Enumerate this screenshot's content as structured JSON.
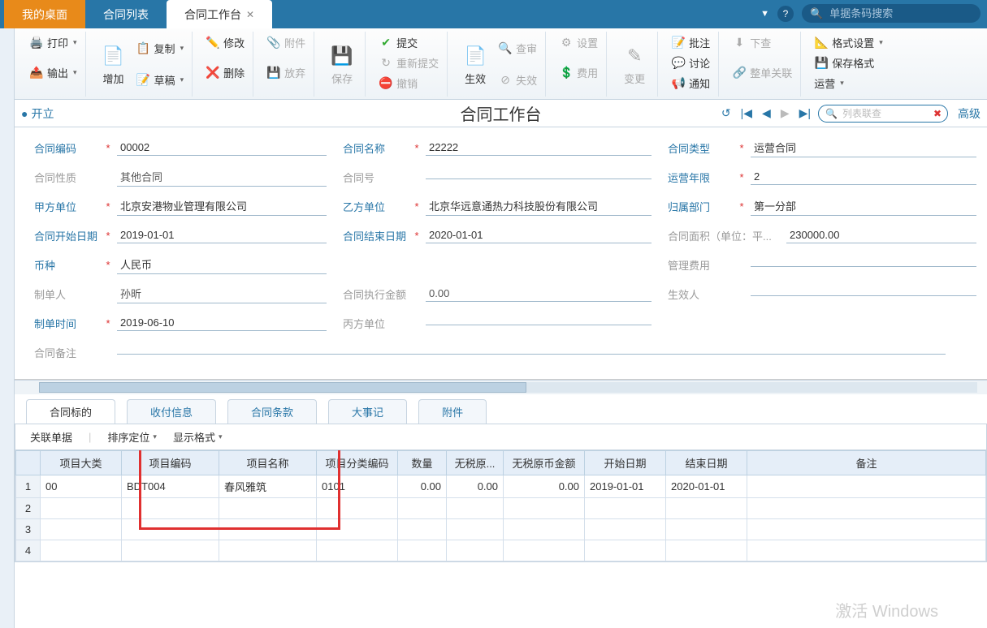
{
  "top_tabs": {
    "t0": "我的桌面",
    "t1": "合同列表",
    "t2": "合同工作台"
  },
  "search": {
    "placeholder": "单据条码搜索"
  },
  "ribbon": {
    "print": "打印",
    "export": "输出",
    "add": "增加",
    "copy": "复制",
    "draft": "草稿",
    "modify": "修改",
    "delete": "删除",
    "attach": "附件",
    "discard": "放弃",
    "save": "保存",
    "submit": "提交",
    "resubmit": "重新提交",
    "revoke": "撤销",
    "effect": "生效",
    "review": "查审",
    "invalid": "失效",
    "settings": "设置",
    "fee": "费用",
    "change": "变更",
    "batch": "批注",
    "discuss": "讨论",
    "notify": "通知",
    "download": "下查",
    "wholeassoc": "整单关联",
    "format": "格式设置",
    "saveformat": "保存格式",
    "operate": "运营"
  },
  "status": {
    "state": "开立",
    "title": "合同工作台",
    "list_ph": "列表联查",
    "advanced": "高级"
  },
  "form": {
    "code_l": "合同编码",
    "code_v": "00002",
    "name_l": "合同名称",
    "name_v": "22222",
    "type_l": "合同类型",
    "type_v": "运营合同",
    "nature_l": "合同性质",
    "nature_v": "其他合同",
    "no_l": "合同号",
    "no_v": "",
    "years_l": "运营年限",
    "years_v": "2",
    "partyA_l": "甲方单位",
    "partyA_v": "北京安港物业管理有限公司",
    "partyB_l": "乙方单位",
    "partyB_v": "北京华远意通热力科技股份有限公司",
    "dept_l": "归属部门",
    "dept_v": "第一分部",
    "start_l": "合同开始日期",
    "start_v": "2019-01-01",
    "end_l": "合同结束日期",
    "end_v": "2020-01-01",
    "area_l": "合同面积（单位：平...",
    "area_v": "230000.00",
    "currency_l": "币种",
    "currency_v": "人民币",
    "mgmtfee_l": "管理费用",
    "mgmtfee_v": "",
    "maker_l": "制单人",
    "maker_v": "孙昕",
    "execamt_l": "合同执行金额",
    "execamt_v": "0.00",
    "effperson_l": "生效人",
    "effperson_v": "",
    "maketime_l": "制单时间",
    "maketime_v": "2019-06-10",
    "partyC_l": "丙方单位",
    "partyC_v": "",
    "remark_l": "合同备注",
    "remark_v": ""
  },
  "subtabs": {
    "t0": "合同标的",
    "t1": "收付信息",
    "t2": "合同条款",
    "t3": "大事记",
    "t4": "附件"
  },
  "tab_toolbar": {
    "assoc": "关联单据",
    "sort": "排序定位",
    "display": "显示格式"
  },
  "grid": {
    "headers": {
      "h0": "项目大类",
      "h1": "项目编码",
      "h2": "项目名称",
      "h3": "项目分类编码",
      "h4": "数量",
      "h5": "无税原...",
      "h6": "无税原币金额",
      "h7": "开始日期",
      "h8": "结束日期",
      "h9": "备注"
    },
    "row1": {
      "c0": "00",
      "c1": "BDT004",
      "c2": "春风雅筑",
      "c3": "0101",
      "c4": "0.00",
      "c5": "0.00",
      "c6": "0.00",
      "c7": "2019-01-01",
      "c8": "2020-01-01",
      "c9": ""
    }
  },
  "watermark": "激活 Windows"
}
